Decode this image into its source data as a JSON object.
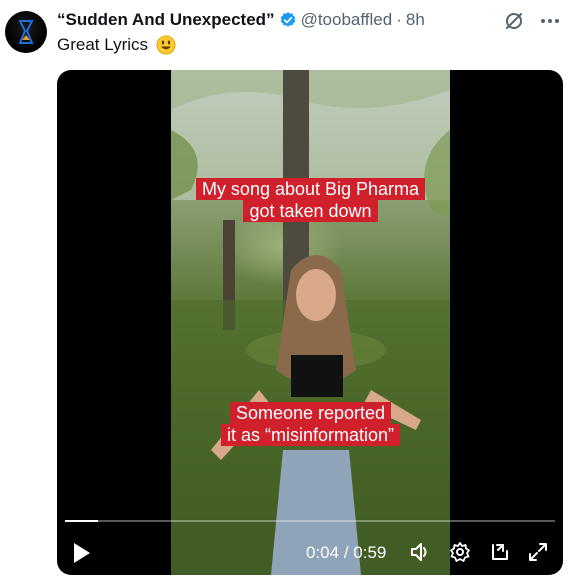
{
  "tweet": {
    "display_name": "“Sudden And Unexpected”",
    "handle": "@toobaffled",
    "separator": "·",
    "time": "8h",
    "text": "Great Lyrics"
  },
  "video": {
    "caption_top_line1": "My song about Big Pharma",
    "caption_top_line2": "got taken down",
    "caption_bottom_line1": "Someone reported",
    "caption_bottom_line2": "it as “misinformation”",
    "current_time": "0:04",
    "time_separator": "/",
    "duration": "0:59",
    "progress": 0.068
  },
  "colors": {
    "verified": "#1d9bf0",
    "caption_bg": "#d0202b",
    "muted_text": "#536471"
  },
  "icons": [
    "avatar-hourglass-icon",
    "verified-badge-icon",
    "grok-icon",
    "more-icon",
    "emoji-smile-icon",
    "play-icon",
    "volume-icon",
    "settings-icon",
    "pip-icon",
    "fullscreen-icon"
  ]
}
